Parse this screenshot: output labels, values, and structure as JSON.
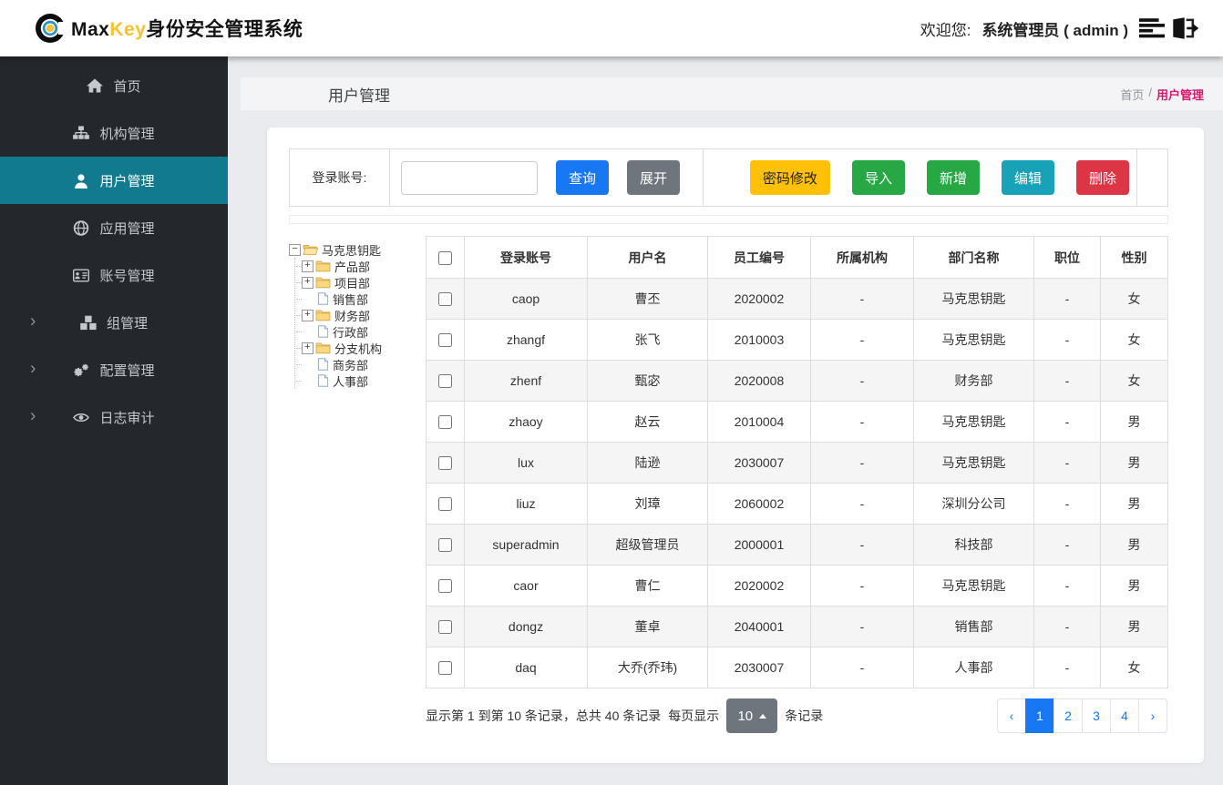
{
  "topbar": {
    "brand": {
      "max": "Max",
      "key": "Key",
      "suffix": "身份安全管理系统"
    },
    "welcome_label": "欢迎您:",
    "user_name": "系统管理员 ( admin )"
  },
  "sidebar": {
    "items": [
      {
        "label": "首页",
        "icon": "home-icon",
        "active": false,
        "expandable": false
      },
      {
        "label": "机构管理",
        "icon": "sitemap-icon",
        "active": false,
        "expandable": false
      },
      {
        "label": "用户管理",
        "icon": "user-icon",
        "active": true,
        "expandable": false
      },
      {
        "label": "应用管理",
        "icon": "globe-icon",
        "active": false,
        "expandable": false
      },
      {
        "label": "账号管理",
        "icon": "id-card-icon",
        "active": false,
        "expandable": false
      },
      {
        "label": "组管理",
        "icon": "cubes-icon",
        "active": false,
        "expandable": true
      },
      {
        "label": "配置管理",
        "icon": "gears-icon",
        "active": false,
        "expandable": true
      },
      {
        "label": "日志审计",
        "icon": "eye-icon",
        "active": false,
        "expandable": true
      }
    ]
  },
  "page": {
    "title": "用户管理",
    "breadcrumb": {
      "home": "首页",
      "separator": "/",
      "current": "用户管理"
    }
  },
  "filter": {
    "label": "登录账号:",
    "input_value": "",
    "query_button": "查询",
    "expand_button": "展开"
  },
  "actions": {
    "change_password": "密码修改",
    "import": "导入",
    "add": "新增",
    "edit": "编辑",
    "delete": "删除"
  },
  "tree": {
    "root": "马克思钥匙",
    "children": [
      {
        "label": "产品部",
        "type": "folder"
      },
      {
        "label": "项目部",
        "type": "folder"
      },
      {
        "label": "销售部",
        "type": "leaf"
      },
      {
        "label": "财务部",
        "type": "folder"
      },
      {
        "label": "行政部",
        "type": "leaf"
      },
      {
        "label": "分支机构",
        "type": "folder"
      },
      {
        "label": "商务部",
        "type": "leaf"
      },
      {
        "label": "人事部",
        "type": "leaf"
      }
    ]
  },
  "table": {
    "columns": [
      "登录账号",
      "用户名",
      "员工编号",
      "所属机构",
      "部门名称",
      "职位",
      "性别"
    ],
    "rows": [
      [
        "caop",
        "曹丕",
        "2020002",
        "-",
        "马克思钥匙",
        "-",
        "女"
      ],
      [
        "zhangf",
        "张飞",
        "2010003",
        "-",
        "马克思钥匙",
        "-",
        "女"
      ],
      [
        "zhenf",
        "甄宓",
        "2020008",
        "-",
        "财务部",
        "-",
        "女"
      ],
      [
        "zhaoy",
        "赵云",
        "2010004",
        "-",
        "马克思钥匙",
        "-",
        "男"
      ],
      [
        "lux",
        "陆逊",
        "2030007",
        "-",
        "马克思钥匙",
        "-",
        "男"
      ],
      [
        "liuz",
        "刘璋",
        "2060002",
        "-",
        "深圳分公司",
        "-",
        "男"
      ],
      [
        "superadmin",
        "超级管理员",
        "2000001",
        "-",
        "科技部",
        "-",
        "男"
      ],
      [
        "caor",
        "曹仁",
        "2020002",
        "-",
        "马克思钥匙",
        "-",
        "男"
      ],
      [
        "dongz",
        "董卓",
        "2040001",
        "-",
        "销售部",
        "-",
        "男"
      ],
      [
        "daq",
        "大乔(乔玮)",
        "2030007",
        "-",
        "人事部",
        "-",
        "女"
      ]
    ]
  },
  "pagination": {
    "summary": "显示第 1 到第 10 条记录，总共 40 条记录",
    "per_page_label": "每页显示",
    "page_size": "10",
    "unit_label": "条记录",
    "prev": "‹",
    "next": "›",
    "pages": [
      "1",
      "2",
      "3",
      "4"
    ],
    "active_page": "1"
  },
  "colors": {
    "primary_blue": "#1877f2",
    "sidebar_bg": "#24272c",
    "sidebar_active_teal": "#117a8f",
    "breadcrumb_active_pink": "#d6186f",
    "brand_yellow": "#f5c332",
    "warning_yellow": "#ffc107",
    "success_green": "#28a745",
    "info_teal": "#17a2b8",
    "danger_red": "#dc3545",
    "striped_row": "#f5f5f6"
  }
}
